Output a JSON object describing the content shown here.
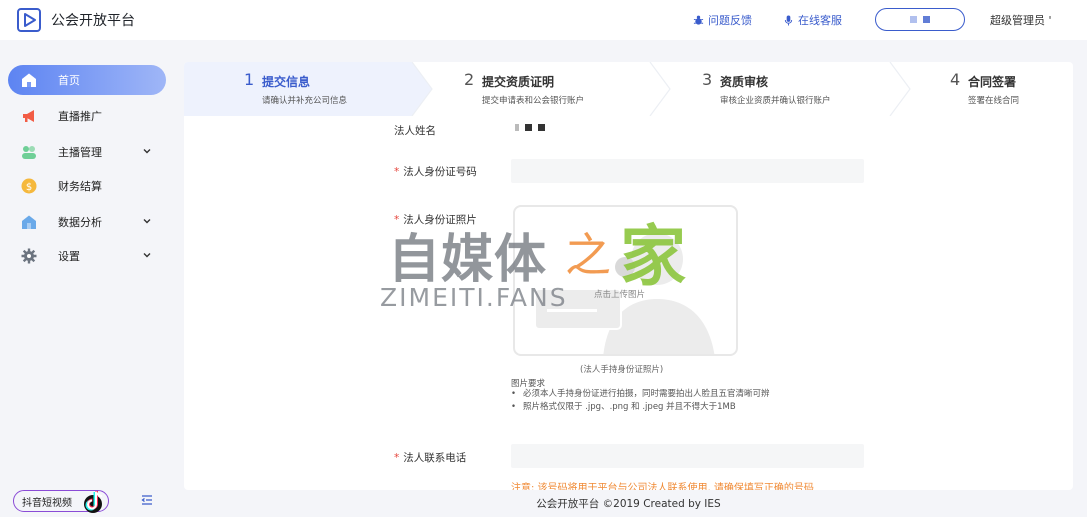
{
  "header": {
    "app_title": "公会开放平台",
    "feedback": "问题反馈",
    "support": "在线客服",
    "admin": "超级管理员 '"
  },
  "sidebar": {
    "items": [
      {
        "label": "首页",
        "icon": "home-icon",
        "active": true
      },
      {
        "label": "直播推广",
        "icon": "megaphone-icon"
      },
      {
        "label": "主播管理",
        "icon": "people-icon",
        "expandable": true
      },
      {
        "label": "财务结算",
        "icon": "coin-icon"
      },
      {
        "label": "数据分析",
        "icon": "house-icon",
        "expandable": true
      },
      {
        "label": "设置",
        "icon": "gear-icon",
        "expandable": true
      }
    ],
    "douyin_label": "抖音短视频"
  },
  "steps": [
    {
      "num": "1",
      "title": "提交信息",
      "desc": "请确认并补充公司信息"
    },
    {
      "num": "2",
      "title": "提交资质证明",
      "desc": "提交申请表和公会银行账户"
    },
    {
      "num": "3",
      "title": "资质审核",
      "desc": "审核企业资质并确认银行账户"
    },
    {
      "num": "4",
      "title": "合同签署",
      "desc": "签署在线合同"
    }
  ],
  "form": {
    "legal_name_label": "法人姓名",
    "id_number_label": "法人身份证号码",
    "id_photo_label": "法人身份证照片",
    "upload_text": "点击上传图片",
    "upload_caption": "(法人手持身份证照片)",
    "requirements_title": "图片要求",
    "requirements": [
      "必须本人手持身份证进行拍摄，同时需要拍出人脸且五官清晰可辨",
      "照片格式仅限于 .jpg、.png 和 .jpeg 并且不得大于1MB"
    ],
    "phone_label": "法人联系电话",
    "phone_note": "注意: 该号码将用于平台与公司法人联系使用, 请确保填写正确的号码",
    "required_mark": "*"
  },
  "watermark": {
    "cn": "自媒体",
    "zhi": "之",
    "jia": "家",
    "en": "ZIMEITI.FANS"
  },
  "footer": "公会开放平台 ©2019 Created by IES",
  "colors": {
    "accent": "#3a5ccc",
    "active_gradient_start": "#5d84f2",
    "warning": "#f08a34",
    "required": "#e6453c"
  }
}
